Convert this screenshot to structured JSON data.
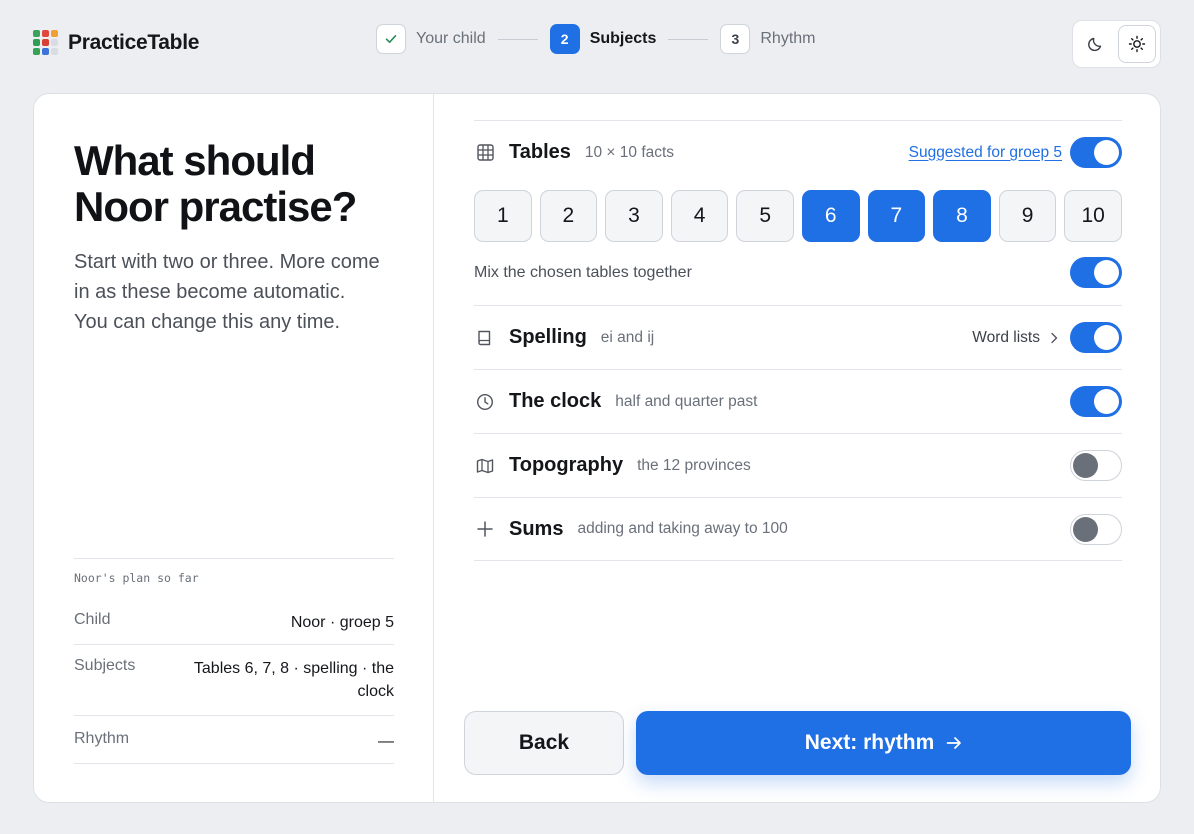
{
  "app": {
    "name": "PracticeTable",
    "logo_colors": [
      "#3aa35b",
      "#e0463c",
      "#f0a133",
      "#2f9e54",
      "#d83f35",
      "#d9dce2",
      "#36a258",
      "#3c73d8",
      "#d9dce2"
    ]
  },
  "stepper": [
    {
      "number": "",
      "label": "Your child",
      "state": "done"
    },
    {
      "number": "2",
      "label": "Subjects",
      "state": "current"
    },
    {
      "number": "3",
      "label": "Rhythm",
      "state": "todo"
    }
  ],
  "theme": {
    "options": [
      "moon-icon",
      "sun-icon"
    ],
    "active": "sun-icon"
  },
  "intro": {
    "title": "What should Noor practise?",
    "description": "Start with two or three. More come in as these become automatic. You can change this any time."
  },
  "plan": {
    "heading": "Noor's plan so far",
    "rows": [
      {
        "key": "Child",
        "value": "Noor · groep 5"
      },
      {
        "key": "Subjects",
        "value": "Tables 6, 7, 8 · spelling · the clock"
      },
      {
        "key": "Rhythm",
        "value": "—"
      }
    ]
  },
  "tables": {
    "title": "Tables",
    "subtitle": "10 × 10 facts",
    "suggestion_link": "Suggested for groep 5",
    "enabled": true,
    "chips": [
      "1",
      "2",
      "3",
      "4",
      "5",
      "6",
      "7",
      "8",
      "9",
      "10"
    ],
    "selected": [
      "6",
      "7",
      "8"
    ],
    "mix_label": "Mix the chosen tables together",
    "mix_enabled": true
  },
  "subjects": [
    {
      "title": "Spelling",
      "subtitle": "ei and ij",
      "extra_link": "Word lists",
      "enabled": true,
      "icon": "book-icon"
    },
    {
      "title": "The clock",
      "subtitle": "half and quarter past",
      "extra_link": "",
      "enabled": true,
      "icon": "clock-icon"
    },
    {
      "title": "Topography",
      "subtitle": "the 12 provinces",
      "extra_link": "",
      "enabled": false,
      "icon": "map-icon"
    },
    {
      "title": "Sums",
      "subtitle": "adding and taking away to 100",
      "extra_link": "",
      "enabled": false,
      "icon": "plus-icon"
    }
  ],
  "actions": {
    "back": "Back",
    "next": "Next: rhythm"
  },
  "colors": {
    "accent": "#1f6fe5",
    "background": "#eceef2"
  }
}
